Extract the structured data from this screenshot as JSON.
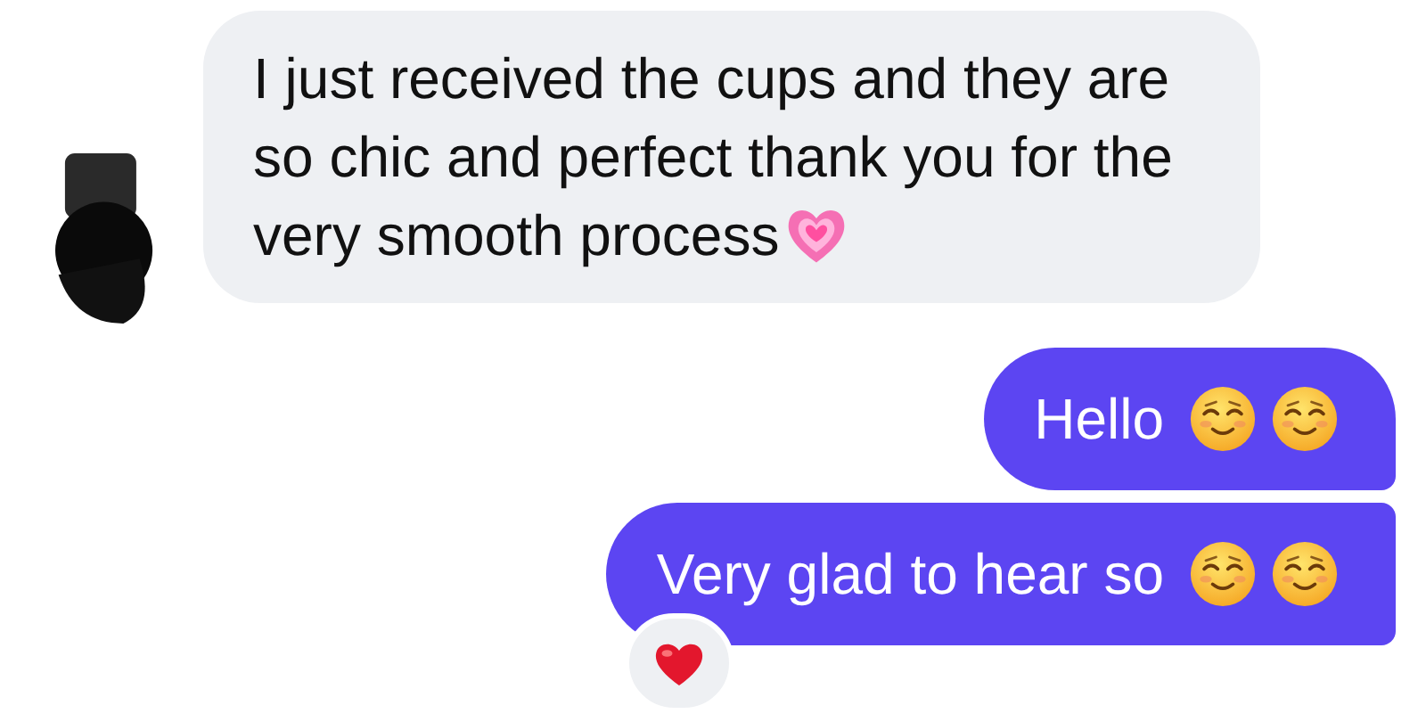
{
  "messages": [
    {
      "kind": "incoming",
      "text": "I just received the cups and they are so chic and perfect thank you for the very smooth process",
      "reacted": false
    },
    {
      "kind": "outgoing",
      "text": "Hello",
      "reacted": false
    },
    {
      "kind": "outgoing",
      "text": "Very glad to hear so",
      "reacted": true
    }
  ]
}
